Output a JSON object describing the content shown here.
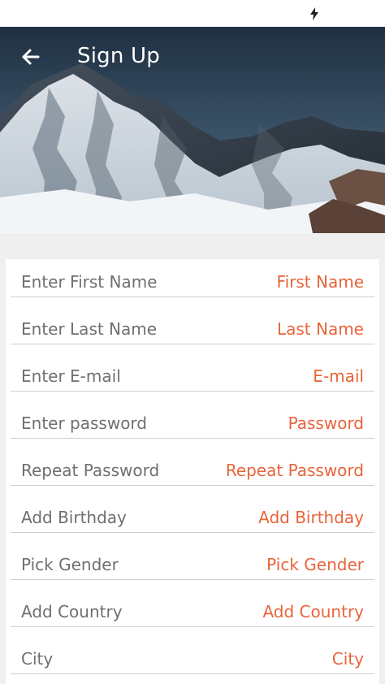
{
  "header": {
    "title": "Sign Up",
    "back_icon": "arrow-left-icon"
  },
  "status_bar": {
    "icon": "charging-bolt-icon"
  },
  "form": {
    "fields": [
      {
        "label": "Enter First Name",
        "value": "First Name"
      },
      {
        "label": "Enter Last Name",
        "value": "Last Name"
      },
      {
        "label": "Enter E-mail",
        "value": "E-mail"
      },
      {
        "label": "Enter password",
        "value": "Password"
      },
      {
        "label": "Repeat Password",
        "value": "Repeat Password"
      },
      {
        "label": "Add Birthday",
        "value": "Add Birthday"
      },
      {
        "label": "Pick Gender",
        "value": "Pick Gender"
      },
      {
        "label": "Add Country",
        "value": "Add Country"
      },
      {
        "label": "City",
        "value": "City"
      }
    ]
  },
  "colors": {
    "accent": "#e8643a",
    "label": "#6f6f6f",
    "divider": "#cfcfcf",
    "background": "#efefef"
  }
}
